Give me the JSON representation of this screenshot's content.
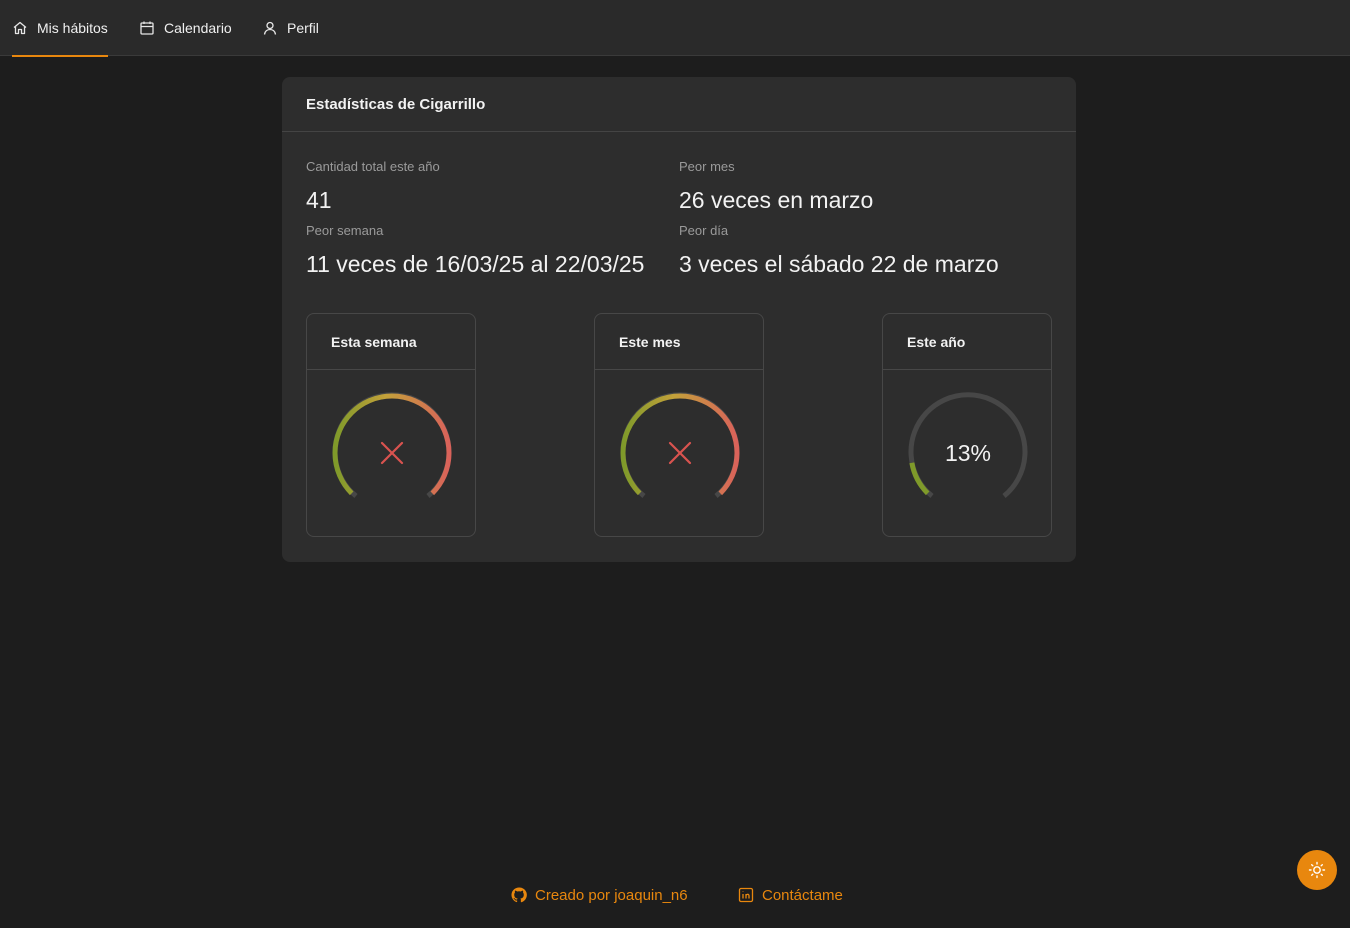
{
  "nav": {
    "items": [
      {
        "label": "Mis hábitos",
        "icon": "home-icon",
        "active": true
      },
      {
        "label": "Calendario",
        "icon": "calendar-icon",
        "active": false
      },
      {
        "label": "Perfil",
        "icon": "user-icon",
        "active": false
      }
    ],
    "accent_color": "#e8870e"
  },
  "card": {
    "title": "Estadísticas de Cigarrillo",
    "stats": {
      "total_label": "Cantidad total este año",
      "total_value": "41",
      "worst_month_label": "Peor mes",
      "worst_month_value": "26 veces en marzo",
      "worst_week_label": "Peor semana",
      "worst_week_value": "11 veces de 16/03/25 al 22/03/25",
      "worst_day_label": "Peor día",
      "worst_day_value": "3 veces el sábado 22 de marzo"
    },
    "gauges": [
      {
        "title": "Esta semana",
        "status": "failed",
        "icon": "close-icon",
        "progress": 1.0
      },
      {
        "title": "Este mes",
        "status": "failed",
        "icon": "close-icon",
        "progress": 1.0
      },
      {
        "title": "Este año",
        "status": "in-progress",
        "text": "13%",
        "progress": 0.13
      }
    ],
    "gauge_colors": {
      "start": "#7f9a2a",
      "mid": "#c4a13a",
      "end": "#d9625a",
      "track": "#474747",
      "fail": "#d9534f"
    }
  },
  "footer": {
    "created_by": "Creado por joaquin_n6",
    "contact": "Contáctame"
  },
  "theme_toggle": {
    "icon": "sun-icon"
  }
}
